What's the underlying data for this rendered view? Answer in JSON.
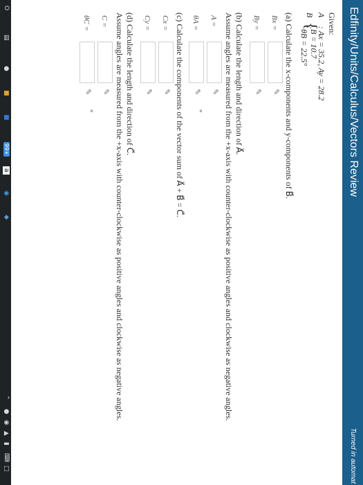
{
  "header": {
    "title": "Edfinity/Units/Calculus/Vectors Review",
    "status": "Turned in automat"
  },
  "problem": {
    "given": "Given:",
    "vector_a": "A⃗ : Ax = 35.2, Ay = 28.2",
    "vector_b_label": "B⃗ :",
    "b_mag": "B = 10.7",
    "b_angle": "θB = 22.5°",
    "part_a": "(a) Calculate the x-components and y-components of B⃗.",
    "part_b": "(b) Calculate the length and direction of A⃗.",
    "part_b_note": "Assume angles are measured from the +x-axis with counter-clockwise as positive angles and clockwise as negative angles.",
    "part_c": "(c) Calculate the components of the vector sum of A⃗ + B⃗ = C⃗.",
    "part_d": "(d) Calculate the length and direction of C⃗.",
    "part_d_note": "Assume angles are measured from the +x-axis with counter-clockwise as positive angles and clockwise as negative angles."
  },
  "answers": {
    "bx": "Bx =",
    "by": "By =",
    "a_len": "A =",
    "theta_a": "θA =",
    "cx": "Cx =",
    "cy": "Cy =",
    "c_len": "C =",
    "theta_c": "θC =",
    "degree": "°",
    "pencil": "✎"
  },
  "taskbar": {
    "start": "O",
    "taskview": "▤",
    "badge": "99+",
    "app_a": "a"
  }
}
